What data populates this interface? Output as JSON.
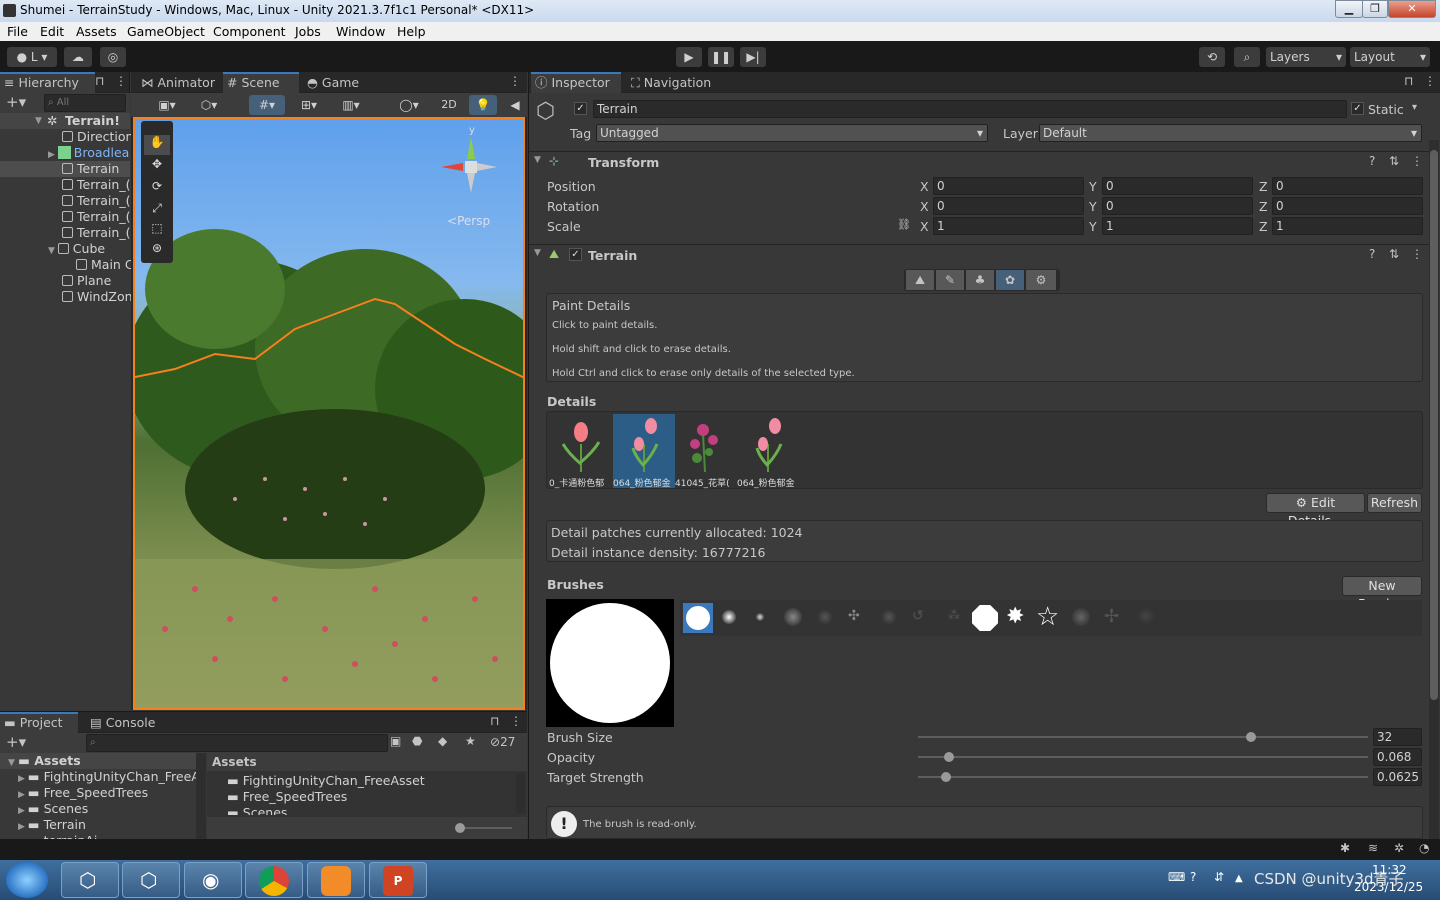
{
  "window": {
    "title": "Shumei - TerrainStudy - Windows, Mac, Linux - Unity 2021.3.7f1c1 Personal* <DX11>"
  },
  "menu": [
    "File",
    "Edit",
    "Assets",
    "GameObject",
    "Component",
    "Jobs",
    "Window",
    "Help"
  ],
  "toolbar": {
    "account": "L",
    "layers": "Layers",
    "layout": "Layout"
  },
  "hierarchy": {
    "tab": "Hierarchy",
    "search_placeholder": "All",
    "items": [
      "Terrain!",
      "Direction",
      "Broadlea",
      "Terrain",
      "Terrain_(",
      "Terrain_(",
      "Terrain_(",
      "Terrain_(",
      "Cube",
      "Main C",
      "Plane",
      "WindZon"
    ]
  },
  "center_tabs": {
    "animator": "Animator",
    "scene": "Scene",
    "game": "Game"
  },
  "scene": {
    "btn_2d": "2D",
    "persp": "Persp",
    "gizmo_y": "y"
  },
  "project": {
    "tab_project": "Project",
    "tab_console": "Console",
    "hidden_count": "27",
    "tree_root": "Assets",
    "tree": [
      "FightingUnityChan_FreeA:",
      "Free_SpeedTrees",
      "Scenes",
      "Terrain",
      "terrainAi"
    ],
    "assets_header": "Assets",
    "assets": [
      "FightingUnityChan_FreeAsset",
      "Free_SpeedTrees",
      "Scenes"
    ]
  },
  "inspector": {
    "tab_inspector": "Inspector",
    "tab_navigation": "Navigation",
    "object_name": "Terrain",
    "static_label": "Static",
    "tag_label": "Tag",
    "tag_value": "Untagged",
    "layer_label": "Layer",
    "layer_value": "Default",
    "transform": {
      "title": "Transform",
      "rows": [
        {
          "label": "Position",
          "x": "0",
          "y": "0",
          "z": "0"
        },
        {
          "label": "Rotation",
          "x": "0",
          "y": "0",
          "z": "0"
        },
        {
          "label": "Scale",
          "x": "1",
          "y": "1",
          "z": "1"
        }
      ],
      "axes": [
        "X",
        "Y",
        "Z"
      ]
    },
    "terrain": {
      "title": "Terrain",
      "paint_title": "Paint Details",
      "paint_lines": [
        "Click to paint details.",
        "Hold shift and click to erase details.",
        "Hold Ctrl and click to erase only details of the selected type."
      ],
      "details_label": "Details",
      "details_items": [
        "0_卡通粉色郁",
        "064_粉色郁金",
        "41045_花草(",
        "064_粉色郁金"
      ],
      "edit_details": "Edit Details...",
      "refresh": "Refresh",
      "patches": "Detail patches currently allocated: 1024",
      "density": "Detail instance density: 16777216",
      "brushes_label": "Brushes",
      "new_brush": "New Brush...",
      "brush_size_label": "Brush Size",
      "brush_size": "32",
      "brush_size_level": 0.74,
      "opacity_label": "Opacity",
      "opacity": "0.068",
      "opacity_level": 0.068,
      "target_label": "Target Strength",
      "target": "0.0625",
      "target_level": 0.0625,
      "readonly": "The brush is read-only."
    }
  },
  "taskbar": {
    "time": "11:32",
    "date": "2023/12/25",
    "watermark": "CSDN @unity3d青子"
  },
  "colors": {
    "accent": "#3a79bb",
    "panel": "#383838",
    "selection": "#2c5d87",
    "orange_outline": "#f7801d"
  }
}
